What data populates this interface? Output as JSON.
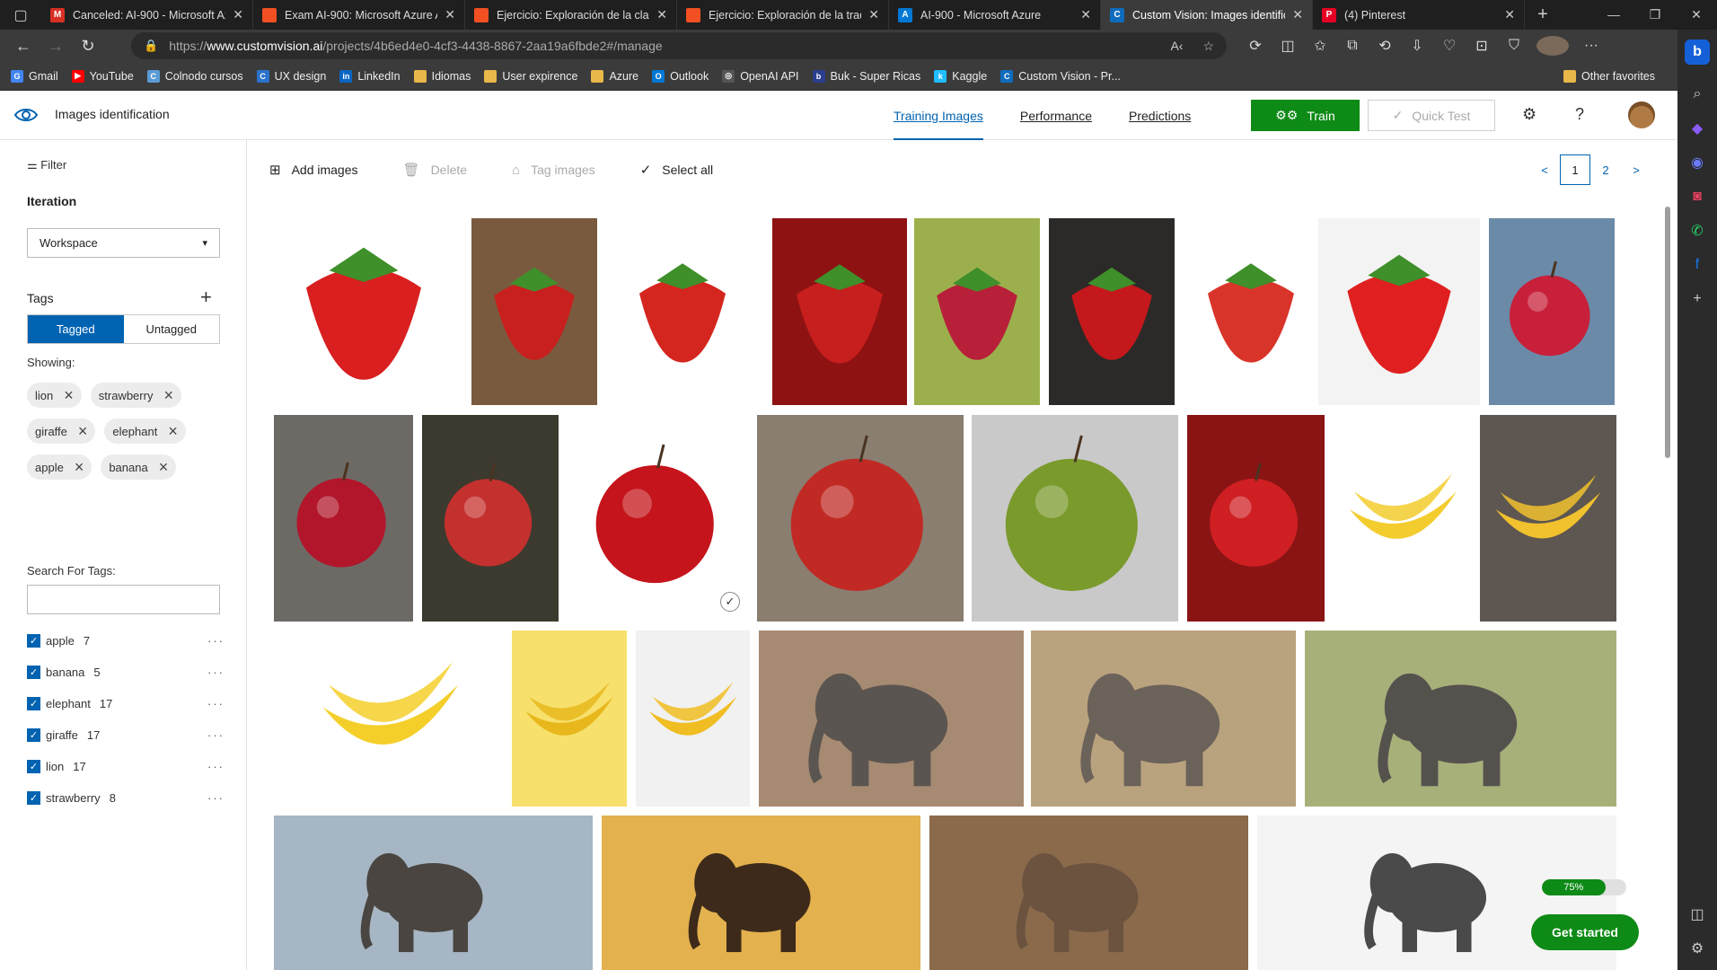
{
  "browser": {
    "tabs": [
      {
        "title": "Canceled: AI-900 - Microsoft Azu",
        "fav": "gmail-icon",
        "color": "#d93025",
        "glyph": "M"
      },
      {
        "title": "Exam AI-900: Microsoft Azure AI",
        "fav": "microsoft-icon",
        "color": "#f25022",
        "glyph": ""
      },
      {
        "title": "Ejercicio: Exploración de la clasif",
        "fav": "microsoft-icon",
        "color": "#f25022",
        "glyph": ""
      },
      {
        "title": "Ejercicio: Exploración de la tradu",
        "fav": "microsoft-icon",
        "color": "#f25022",
        "glyph": ""
      },
      {
        "title": "AI-900 - Microsoft Azure",
        "fav": "azure-icon",
        "color": "#0078d4",
        "glyph": "A"
      },
      {
        "title": "Custom Vision: Images identificat",
        "fav": "customvision-icon",
        "color": "#0f6cbd",
        "glyph": "C"
      },
      {
        "title": "(4) Pinterest",
        "fav": "pinterest-icon",
        "color": "#e60023",
        "glyph": "P"
      }
    ],
    "active_tab": 5,
    "url_prefix": "https://",
    "url_domain": "www.customvision.ai",
    "url_path": "/projects/4b6ed4e0-4cf3-4438-8867-2aa19a6fbde2#/manage",
    "bookmarks": [
      {
        "label": "Gmail",
        "icon": "google-icon",
        "color": "#4285f4",
        "glyph": "G"
      },
      {
        "label": "YouTube",
        "icon": "youtube-icon",
        "color": "#ff0000",
        "glyph": "▶"
      },
      {
        "label": "Colnodo cursos",
        "icon": "globe-icon",
        "color": "#5b9bd5",
        "glyph": "C"
      },
      {
        "label": "UX design",
        "icon": "coursera-icon",
        "color": "#2a73cc",
        "glyph": "C"
      },
      {
        "label": "LinkedIn",
        "icon": "linkedin-icon",
        "color": "#0a66c2",
        "glyph": "in"
      },
      {
        "label": "Idiomas",
        "icon": "folder-icon",
        "color": "#e8b84a",
        "glyph": ""
      },
      {
        "label": "User expirence",
        "icon": "folder-icon",
        "color": "#e8b84a",
        "glyph": ""
      },
      {
        "label": "Azure",
        "icon": "folder-icon",
        "color": "#e8b84a",
        "glyph": ""
      },
      {
        "label": "Outlook",
        "icon": "outlook-icon",
        "color": "#0078d4",
        "glyph": "O"
      },
      {
        "label": "OpenAI API",
        "icon": "openai-icon",
        "color": "#555555",
        "glyph": "◎"
      },
      {
        "label": "Buk - Super Ricas",
        "icon": "buk-icon",
        "color": "#2c3e8f",
        "glyph": "b"
      },
      {
        "label": "Kaggle",
        "icon": "kaggle-icon",
        "color": "#20beff",
        "glyph": "k"
      },
      {
        "label": "Custom Vision - Pr...",
        "icon": "customvision-icon",
        "color": "#0f6cbd",
        "glyph": "C"
      }
    ],
    "other_favorites": "Other favorites"
  },
  "app": {
    "project_name": "Images identification",
    "nav": [
      "Training Images",
      "Performance",
      "Predictions"
    ],
    "active_nav": 0,
    "train_label": "Train",
    "quick_test_label": "Quick Test"
  },
  "sidebar": {
    "filter_label": "Filter",
    "iteration_label": "Iteration",
    "iteration_value": "Workspace",
    "tags_label": "Tags",
    "tagged_label": "Tagged",
    "untagged_label": "Untagged",
    "showing_label": "Showing:",
    "chips": [
      "lion",
      "strawberry",
      "giraffe",
      "elephant",
      "apple",
      "banana"
    ],
    "search_label": "Search For Tags:",
    "search_value": "",
    "tag_list": [
      {
        "name": "apple",
        "count": "7"
      },
      {
        "name": "banana",
        "count": "5"
      },
      {
        "name": "elephant",
        "count": "17"
      },
      {
        "name": "giraffe",
        "count": "17"
      },
      {
        "name": "lion",
        "count": "17"
      },
      {
        "name": "strawberry",
        "count": "8"
      }
    ]
  },
  "toolbar": {
    "add_images": "Add images",
    "delete": "Delete",
    "tag_images": "Tag images",
    "select_all": "Select all"
  },
  "pager": {
    "prev": "<",
    "pages": [
      "1",
      "2"
    ],
    "current": "1",
    "next": ">"
  },
  "images": [
    {
      "subject": "strawberry",
      "bg": "#ffffff",
      "fg": "#d91f1f"
    },
    {
      "subject": "strawberry",
      "bg": "#7a5a3e",
      "fg": "#c8201e"
    },
    {
      "subject": "strawberry",
      "bg": "#ffffff",
      "fg": "#d4251e"
    },
    {
      "subject": "strawberry",
      "bg": "#8e1212",
      "fg": "#c71e1e"
    },
    {
      "subject": "strawberry",
      "bg": "#9bb04c",
      "fg": "#b8203a"
    },
    {
      "subject": "strawberry",
      "bg": "#2c2a28",
      "fg": "#c4181c"
    },
    {
      "subject": "strawberry",
      "bg": "#ffffff",
      "fg": "#d9342a"
    },
    {
      "subject": "strawberry",
      "bg": "#f3f3f3",
      "fg": "#e02020"
    },
    {
      "subject": "apple",
      "bg": "#6a8aa8",
      "fg": "#c8203a"
    },
    {
      "subject": "apple",
      "bg": "#6d6a66",
      "fg": "#b2162b"
    },
    {
      "subject": "apple",
      "bg": "#3c3a2e",
      "fg": "#c4302e"
    },
    {
      "subject": "apple",
      "bg": "#ffffff",
      "fg": "#c5141b"
    },
    {
      "subject": "apple",
      "bg": "#8a7e70",
      "fg": "#c12a24"
    },
    {
      "subject": "apple",
      "bg": "#c9c9c9",
      "fg": "#7a9a2c"
    },
    {
      "subject": "apple",
      "bg": "#8a1414",
      "fg": "#cf1f22"
    },
    {
      "subject": "banana",
      "bg": "#ffffff",
      "fg": "#f3cc2e"
    },
    {
      "subject": "banana",
      "bg": "#5e5650",
      "fg": "#f1c12e"
    },
    {
      "subject": "banana",
      "bg": "#ffffff",
      "fg": "#f4cf2a"
    },
    {
      "subject": "banana",
      "bg": "#f7e06c",
      "fg": "#e7b71c"
    },
    {
      "subject": "banana",
      "bg": "#f1f1f1",
      "fg": "#f0bd22"
    },
    {
      "subject": "elephant",
      "bg": "#a68a72",
      "fg": "#5a5550"
    },
    {
      "subject": "elephant",
      "bg": "#b9a27e",
      "fg": "#6b625a"
    },
    {
      "subject": "elephant",
      "bg": "#a8b07a",
      "fg": "#55524e"
    },
    {
      "subject": "elephant",
      "bg": "#a6b6c4",
      "fg": "#4a4540"
    },
    {
      "subject": "elephant",
      "bg": "#e3b14e",
      "fg": "#3d2a1a"
    },
    {
      "subject": "elephant",
      "bg": "#8a6a4a",
      "fg": "#6b5340"
    },
    {
      "subject": "elephant",
      "bg": "#f4f4f4",
      "fg": "#4a4a4a"
    }
  ],
  "selected_image": 11,
  "progress": {
    "label": "75%",
    "value": 0.75
  },
  "get_started": "Get started",
  "colors": {
    "accent": "#0063b1",
    "train_green": "#0e8a16",
    "tab_bg": "#1f1f1f",
    "chrome_bg": "#3b3b3b"
  }
}
